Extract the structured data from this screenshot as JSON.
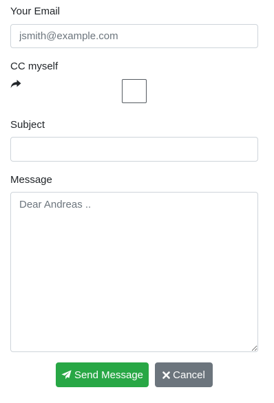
{
  "form": {
    "email_label": "Your Email",
    "email_placeholder": "jsmith@example.com",
    "cc_label": "CC myself",
    "subject_label": "Subject",
    "message_label": "Message",
    "message_placeholder": "Dear Andreas ..",
    "cc_checked": false
  },
  "buttons": {
    "send_label": "Send Message",
    "cancel_label": "Cancel"
  },
  "icons": {
    "cc": "share-icon",
    "send": "paper-plane-icon",
    "cancel": "close-icon"
  },
  "colors": {
    "send_button": "#28a745",
    "cancel_button": "#6c757d",
    "input_border": "#ced4da"
  }
}
